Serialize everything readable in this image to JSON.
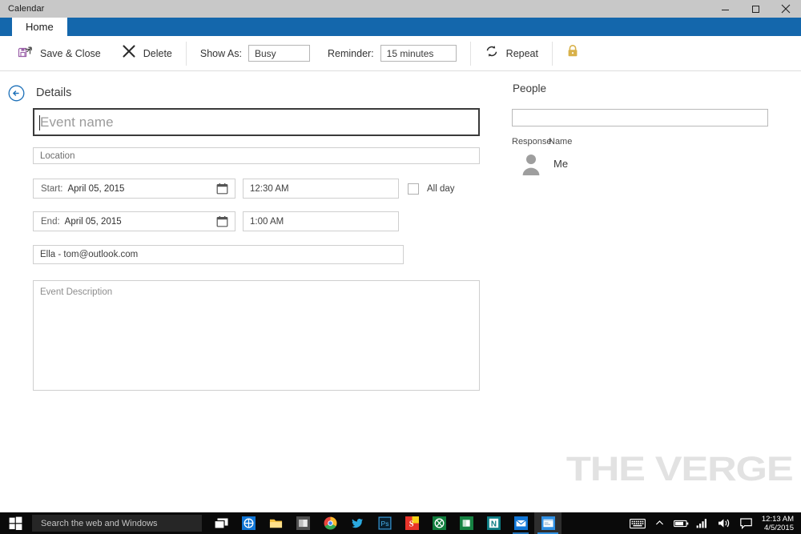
{
  "window": {
    "title": "Calendar",
    "controls": {
      "minimize": "minimize-button",
      "maximize": "restore-button",
      "close": "close-button"
    }
  },
  "ribbon": {
    "tabs": [
      {
        "label": "Home",
        "active": true
      }
    ],
    "save_close_label": "Save & Close",
    "delete_label": "Delete",
    "show_as_label": "Show As:",
    "show_as_value": "Busy",
    "reminder_label": "Reminder:",
    "reminder_value": "15 minutes",
    "repeat_label": "Repeat",
    "private_icon": "lock-icon",
    "accent_color": "#1467ac",
    "lock_color": "#d8b14a",
    "save_icon_color": "#9a5fa8"
  },
  "details": {
    "heading": "Details",
    "back_label": "back-arrow",
    "event_name_placeholder": "Event name",
    "location_placeholder": "Location",
    "start_label": "Start:",
    "start_date": "April 05, 2015",
    "start_time": "12:30 AM",
    "all_day_label": "All day",
    "all_day_checked": false,
    "end_label": "End:",
    "end_date": "April 05, 2015",
    "end_time": "1:00 AM",
    "account": "Ella - tom@outlook.com",
    "description_placeholder": "Event Description"
  },
  "people": {
    "heading": "People",
    "invite_value": "",
    "invite_placeholder": "",
    "columns": {
      "response": "Response",
      "name": "Name"
    },
    "attendees": [
      {
        "name": "Me",
        "avatar": "person-avatar"
      }
    ]
  },
  "watermark": {
    "text": "THE VERGE",
    "color": "#e2e2e2"
  },
  "taskbar": {
    "start_icon": "windows-logo-icon",
    "search_placeholder": "Search the web and Windows",
    "pinned": [
      {
        "name": "task-view-icon",
        "label": "Task View"
      },
      {
        "name": "edge-icon",
        "label": "Microsoft Edge"
      },
      {
        "name": "file-explorer-icon",
        "label": "File Explorer"
      },
      {
        "name": "store-icon",
        "label": "Store"
      },
      {
        "name": "chrome-icon",
        "label": "Google Chrome"
      },
      {
        "name": "twitter-icon",
        "label": "Twitter"
      },
      {
        "name": "photoshop-icon",
        "label": "Photoshop"
      },
      {
        "name": "snagit-icon",
        "label": "Snagit"
      },
      {
        "name": "xbox-icon",
        "label": "Xbox"
      },
      {
        "name": "office-icon",
        "label": "Office"
      },
      {
        "name": "onenote-icon",
        "label": "OneNote"
      },
      {
        "name": "mail-icon",
        "label": "Mail"
      },
      {
        "name": "calendar-icon",
        "label": "Calendar"
      }
    ],
    "tray": [
      {
        "name": "touch-keyboard-icon"
      },
      {
        "name": "show-hidden-icons-chevron"
      },
      {
        "name": "battery-icon"
      },
      {
        "name": "network-signal-icon"
      },
      {
        "name": "volume-icon"
      },
      {
        "name": "action-center-icon"
      }
    ],
    "clock_time": "12:13 AM",
    "clock_date": "4/5/2015"
  }
}
